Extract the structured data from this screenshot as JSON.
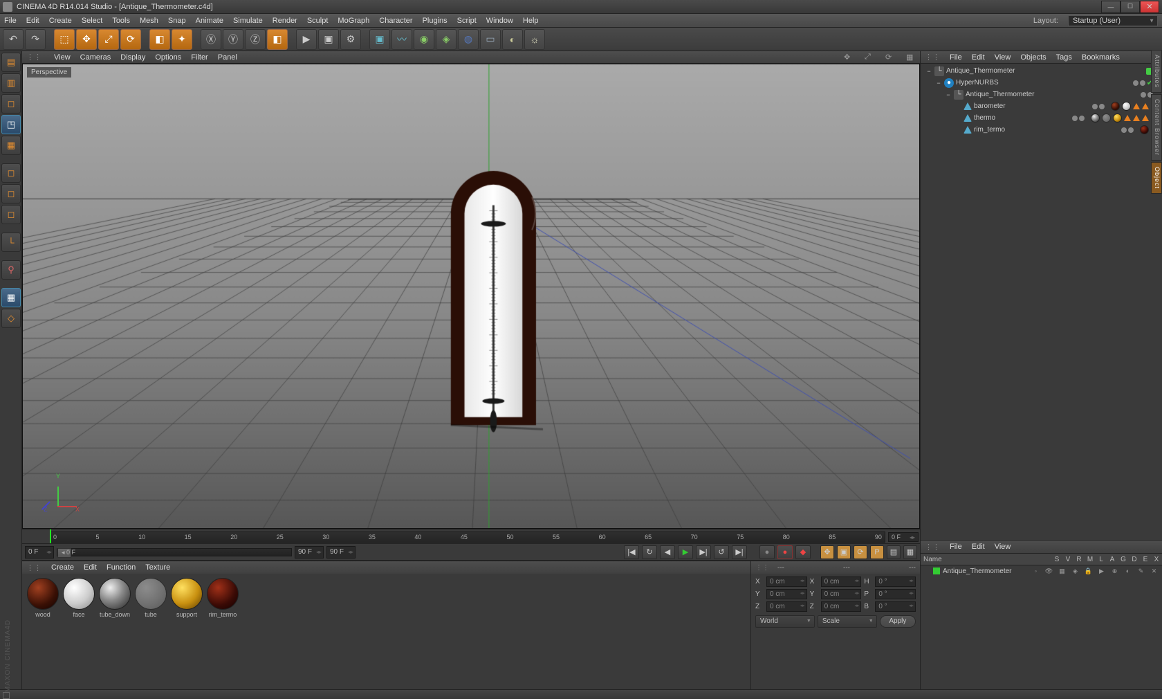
{
  "titlebar": {
    "text": "CINEMA 4D R14.014 Studio - [Antique_Thermometer.c4d]"
  },
  "menu": {
    "items": [
      "File",
      "Edit",
      "Create",
      "Select",
      "Tools",
      "Mesh",
      "Snap",
      "Animate",
      "Simulate",
      "Render",
      "Sculpt",
      "MoGraph",
      "Character",
      "Plugins",
      "Script",
      "Window",
      "Help"
    ],
    "layout_label": "Layout:",
    "layout_value": "Startup (User)"
  },
  "viewmenu": {
    "items": [
      "View",
      "Cameras",
      "Display",
      "Options",
      "Filter",
      "Panel"
    ],
    "label": "Perspective"
  },
  "timeline": {
    "ticks": [
      "0",
      "5",
      "10",
      "15",
      "20",
      "25",
      "30",
      "35",
      "40",
      "45",
      "50",
      "55",
      "60",
      "65",
      "70",
      "75",
      "80",
      "85",
      "90"
    ],
    "endcap": "0 F"
  },
  "play": {
    "start": "0 F",
    "slider_start": "0 F",
    "slider_end": "90 F",
    "end": "90 F"
  },
  "materials": {
    "menu": [
      "Create",
      "Edit",
      "Function",
      "Texture"
    ],
    "slots": [
      {
        "name": "wood",
        "class": "wood"
      },
      {
        "name": "face",
        "class": "face"
      },
      {
        "name": "tube_down",
        "class": "tubedown"
      },
      {
        "name": "tube",
        "class": "tube"
      },
      {
        "name": "support",
        "class": "support"
      },
      {
        "name": "rim_termo",
        "class": "rim"
      }
    ]
  },
  "coord": {
    "head": [
      "---",
      "---",
      "---"
    ],
    "rows": [
      {
        "l": "X",
        "v": "0 cm",
        "l2": "X",
        "v2": "0 cm",
        "l3": "H",
        "v3": "0 °"
      },
      {
        "l": "Y",
        "v": "0 cm",
        "l2": "Y",
        "v2": "0 cm",
        "l3": "P",
        "v3": "0 °"
      },
      {
        "l": "Z",
        "v": "0 cm",
        "l2": "Z",
        "v2": "0 cm",
        "l3": "B",
        "v3": "0 °"
      }
    ],
    "mode1": "World",
    "mode2": "Scale",
    "apply": "Apply"
  },
  "objects": {
    "menu": [
      "File",
      "Edit",
      "View",
      "Objects",
      "Tags",
      "Bookmarks"
    ],
    "tree": [
      {
        "depth": 0,
        "icon": "null",
        "name": "Antique_Thermometer",
        "exp": "−",
        "ctl": "green"
      },
      {
        "depth": 1,
        "icon": "hn",
        "name": "HyperNURBS",
        "exp": "−",
        "ctl": "dotsV"
      },
      {
        "depth": 2,
        "icon": "null",
        "name": "Antique_Thermometer",
        "exp": "−",
        "ctl": "dots"
      },
      {
        "depth": 3,
        "icon": "poly",
        "name": "barometer",
        "exp": "",
        "ctl": "dots",
        "tags": [
          "ball-wood",
          "ball-face",
          "tri",
          "tri",
          "chk"
        ]
      },
      {
        "depth": 3,
        "icon": "poly",
        "name": "thermo",
        "exp": "",
        "ctl": "dots",
        "tags": [
          "ball-tubedown",
          "ball-tube",
          "ball-support",
          "tri",
          "tri",
          "tri",
          "chk"
        ]
      },
      {
        "depth": 3,
        "icon": "poly",
        "name": "rim_termo",
        "exp": "",
        "ctl": "dots",
        "tags": [
          "ball-rim",
          "chk"
        ]
      }
    ]
  },
  "attr": {
    "menu": [
      "File",
      "Edit",
      "View"
    ],
    "namecol": "Name",
    "cols": [
      "S",
      "V",
      "R",
      "M",
      "L",
      "A",
      "G",
      "D",
      "E",
      "X"
    ],
    "layer": "Antique_Thermometer"
  },
  "maxon": "MAXON CINEMA4D",
  "rtabs": [
    "Attributes",
    "Content Browser",
    "Object"
  ]
}
